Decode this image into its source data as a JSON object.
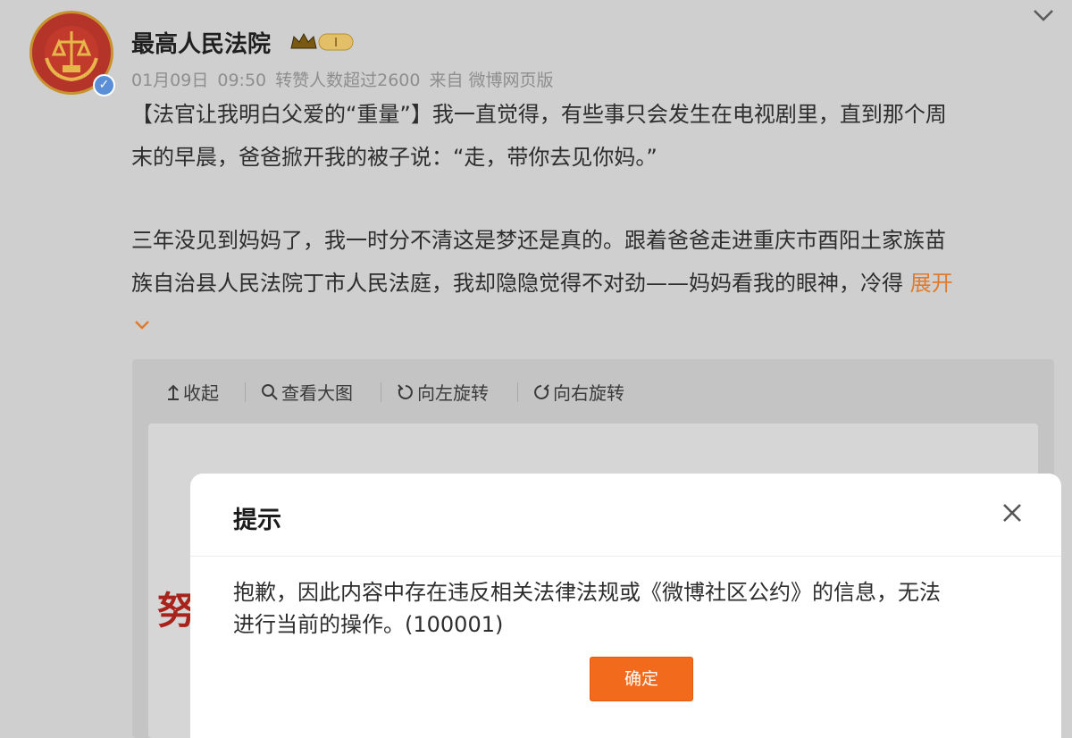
{
  "post": {
    "username": "最高人民法院",
    "badge_level": "I",
    "meta": {
      "date": "01月09日",
      "time": "09:50",
      "stat": "转赞人数超过2600",
      "source": "来自 微博网页版"
    },
    "text_lines": [
      "【法官让我明白父爱的“重量”】我一直觉得，有些事只会发生在电视剧里，直到那个周",
      "末的早晨，爸爸掀开我的被子说：“走，带你去见你妈。”",
      "三年没见到妈妈了，我一时分不清这是梦还是真的。跟着爸爸走进重庆市酉阳土家族苗",
      "族自治县人民法院丁市人民法庭，我却隐隐觉得不对劲——妈妈看我的眼神，冷得 "
    ],
    "expand_label": "展开"
  },
  "image_toolbar": {
    "collapse": "收起",
    "view_large": "查看大图",
    "rotate_left": "向左旋转",
    "rotate_right": "向右旋转"
  },
  "image_glyph": "努",
  "dialog": {
    "title": "提示",
    "message_line1": "抱歉，因此内容中存在违反相关法律法规或《微博社区公约》的信息，无法",
    "message_line2": "进行当前的操作。(100001)",
    "confirm_label": "确定"
  },
  "icons": {
    "crown": "crown-icon",
    "verified": "verified-icon",
    "chevron": "chevron-down-icon",
    "close": "close-icon"
  },
  "colors": {
    "accent_orange": "#f26a1c",
    "link_orange": "#e07b2d",
    "verified_blue": "#5a8fd8",
    "emblem_red": "#b5342a",
    "emblem_gold": "#d9a33a"
  }
}
